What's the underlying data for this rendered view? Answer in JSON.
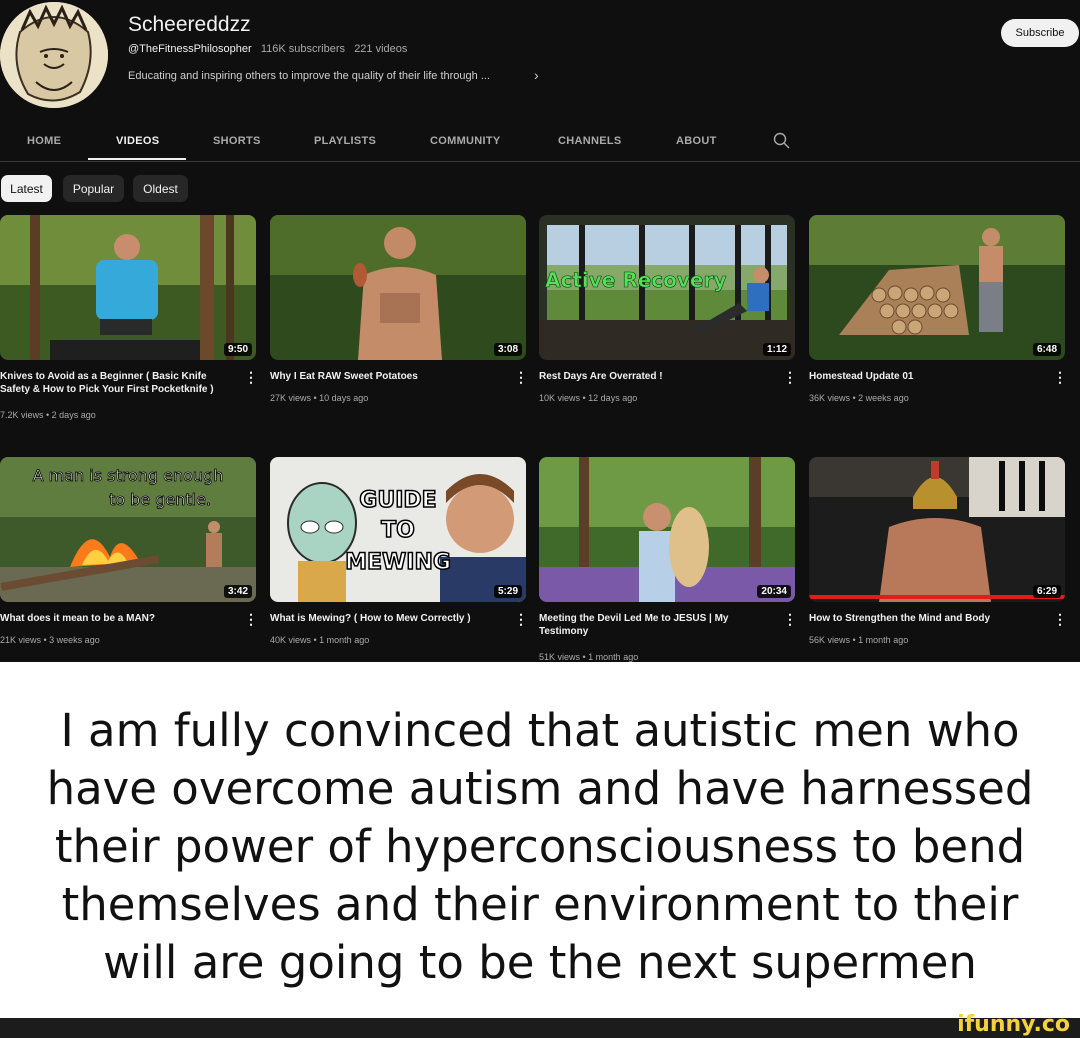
{
  "channel": {
    "name": "Scheereddzz",
    "handle": "@TheFitnessPhilosopher",
    "subscribers": "116K subscribers",
    "video_count": "221 videos",
    "description": "Educating and inspiring others to improve the quality of their life through ...",
    "subscribe_label": "Subscribe"
  },
  "tabs": [
    "HOME",
    "VIDEOS",
    "SHORTS",
    "PLAYLISTS",
    "COMMUNITY",
    "CHANNELS",
    "ABOUT"
  ],
  "active_tab": "VIDEOS",
  "filters": [
    "Latest",
    "Popular",
    "Oldest"
  ],
  "active_filter": "Latest",
  "videos": [
    {
      "title": "Knives to Avoid as a Beginner ( Basic Knife Safety & How to Pick Your First Pocketknife )",
      "meta": "7.2K views • 2 days ago",
      "duration": "9:50"
    },
    {
      "title": "Why I Eat RAW Sweet Potatoes",
      "meta": "27K views • 10 days ago",
      "duration": "3:08"
    },
    {
      "title": "Rest Days Are Overrated !",
      "meta": "10K views • 12 days ago",
      "duration": "1:12",
      "overlay": "Active Recovery"
    },
    {
      "title": "Homestead Update 01",
      "meta": "36K views • 2 weeks ago",
      "duration": "6:48"
    },
    {
      "title": "What does it mean to be a MAN?",
      "meta": "21K views • 3 weeks ago",
      "duration": "3:42",
      "overlay_1": "A man is strong enough",
      "overlay_2": "to be gentle."
    },
    {
      "title": "What is Mewing? ( How to Mew Correctly )",
      "meta": "40K views • 1 month ago",
      "duration": "5:29",
      "overlay_1": "GUIDE",
      "overlay_2": "TO",
      "overlay_3": "MEWING"
    },
    {
      "title": "Meeting the Devil Led Me to JESUS | My Testimony",
      "meta": "51K views • 1 month ago",
      "duration": "20:34"
    },
    {
      "title": "How to Strengthen the Mind and Body",
      "meta": "56K views • 1 month ago",
      "duration": "6:29"
    }
  ],
  "caption": "I am fully convinced that autistic men who have overcome autism and have harnessed their power of hyperconsciousness to bend themselves and their environment to their will are going to be the next supermen",
  "watermark": "ifunny.co",
  "colors": {
    "background": "#0f0f0f",
    "text": "#f1f1f1",
    "muted": "#aaaaaa",
    "chip": "#272727",
    "watermark": "#f5d23a"
  }
}
